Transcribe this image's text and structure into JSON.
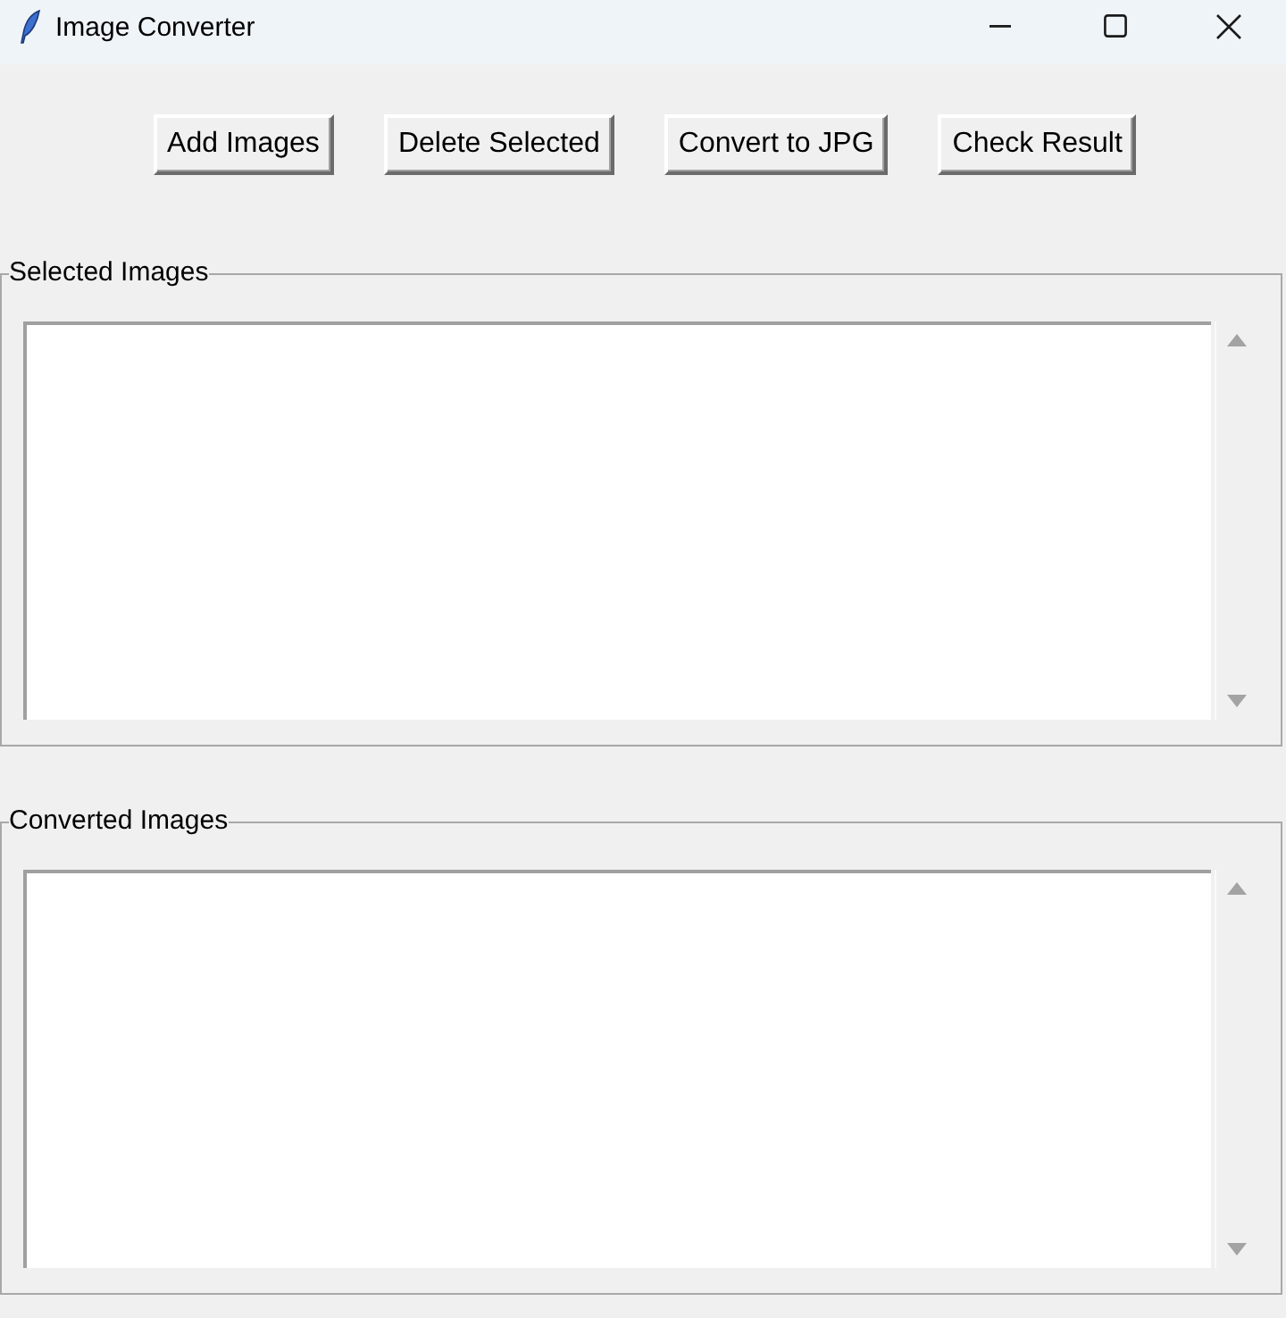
{
  "window": {
    "title": "Image Converter"
  },
  "toolbar": {
    "buttons": [
      "Add Images",
      "Delete Selected",
      "Convert to JPG",
      "Check Result"
    ]
  },
  "groups": [
    {
      "label": "Selected Images"
    },
    {
      "label": "Converted Images"
    }
  ]
}
